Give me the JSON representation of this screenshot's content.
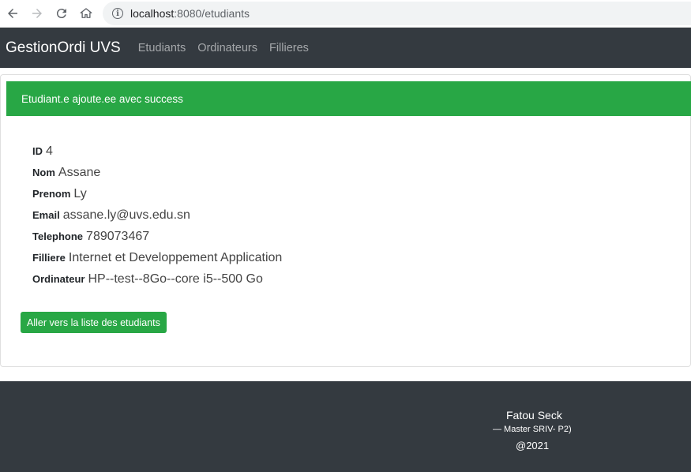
{
  "browser": {
    "url_host": "localhost",
    "url_rest": ":8080/etudiants"
  },
  "navbar": {
    "brand": "GestionOrdi UVS",
    "links": [
      "Etudiants",
      "Ordinateurs",
      "Fillieres"
    ]
  },
  "alert": {
    "message": "Etudiant.e ajoute.ee avec success",
    "color": "#28a745"
  },
  "student": {
    "fields": [
      {
        "label": "ID",
        "value": "4"
      },
      {
        "label": "Nom",
        "value": "Assane"
      },
      {
        "label": "Prenom",
        "value": "Ly"
      },
      {
        "label": "Email",
        "value": "assane.ly@uvs.edu.sn"
      },
      {
        "label": "Telephone",
        "value": "789073467"
      },
      {
        "label": "Filliere",
        "value": "Internet et Developpement Application"
      },
      {
        "label": "Ordinateur",
        "value": "HP--test--8Go--core i5--500 Go"
      }
    ]
  },
  "actions": {
    "back_label": "Aller vers la liste des etudiants"
  },
  "footer": {
    "name": "Fatou Seck",
    "subtitle": "— Master SRIV- P2)",
    "year": "@2021"
  }
}
